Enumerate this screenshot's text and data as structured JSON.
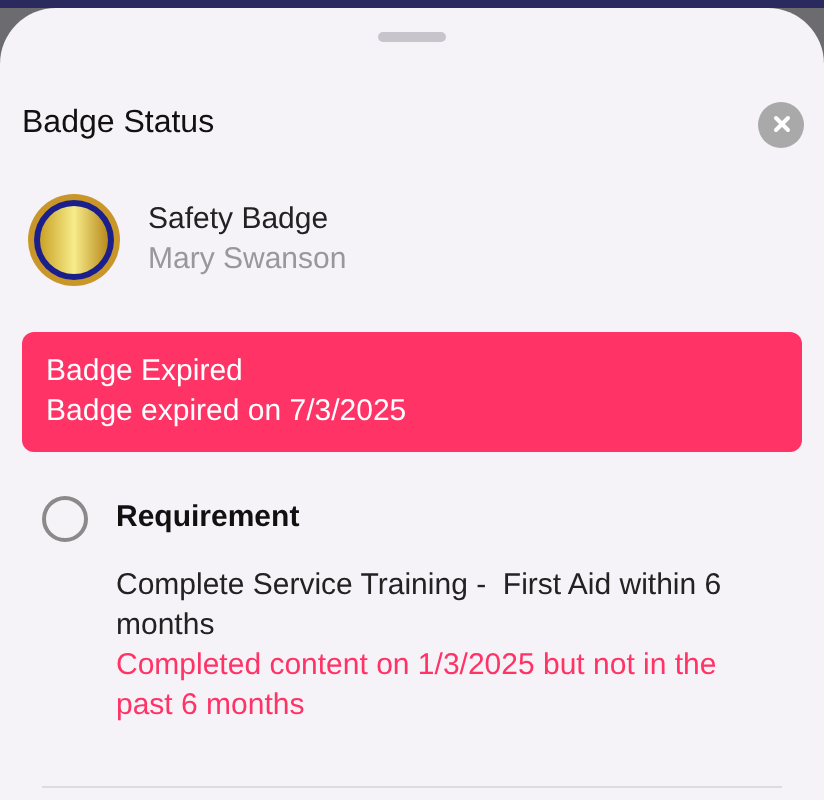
{
  "sheet": {
    "title": "Badge Status"
  },
  "badge": {
    "name": "Safety Badge",
    "holder": "Mary Swanson"
  },
  "alert": {
    "title": "Badge Expired",
    "message": "Badge expired on 7/3/2025"
  },
  "requirements": [
    {
      "label": "Requirement",
      "checked": false,
      "description": "Complete Service Training -  First Aid within 6 months",
      "note": "Completed content on 1/3/2025 but not in the past 6 months"
    }
  ]
}
